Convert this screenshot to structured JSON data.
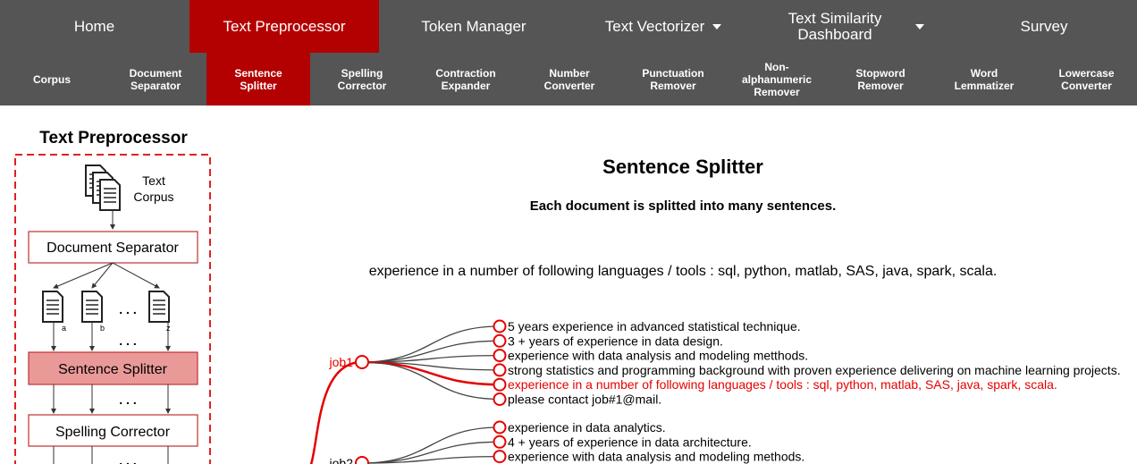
{
  "top_nav": [
    {
      "label": "Home"
    },
    {
      "label": "Text Preprocessor"
    },
    {
      "label": "Token Manager"
    },
    {
      "label": "Text Vectorizer"
    },
    {
      "label": "Text Similarity Dashboard"
    },
    {
      "label": "Survey"
    }
  ],
  "sub_nav": [
    {
      "label": "Corpus"
    },
    {
      "label": "Document Separator"
    },
    {
      "label": "Sentence Splitter"
    },
    {
      "label": "Spelling Corrector"
    },
    {
      "label": "Contraction Expander"
    },
    {
      "label": "Number Converter"
    },
    {
      "label": "Punctuation Remover"
    },
    {
      "label": "Non-alphanumeric Remover"
    },
    {
      "label": "Stopword Remover"
    },
    {
      "label": "Word Lemmatizer"
    },
    {
      "label": "Lowercase Converter"
    }
  ],
  "diagram": {
    "title": "Text Preprocessor",
    "corpus_label_1": "Text",
    "corpus_label_2": "Corpus",
    "doc_separator": "Document Separator",
    "sentence_splitter": "Sentence Splitter",
    "spelling_corrector": "Spelling Corrector",
    "doc_a": "a",
    "doc_b": "b",
    "doc_z": "z",
    "ellipsis": ". . ."
  },
  "content": {
    "title": "Sentence Splitter",
    "subtitle": "Each document is splitted into many sentences.",
    "selected_sentence": "experience in a number of following languages / tools : sql, python, matlab, SAS, java, spark, scala."
  },
  "tree": {
    "jobs": [
      {
        "label": "job1",
        "sentences": [
          "5 years experience in advanced statistical technique.",
          "3 + years of experience in data design.",
          "experience with data analysis and modeling metthods.",
          "strong statistics and programming background with proven experience delivering on machine learning projects.",
          "experience in a number of following languages / tools : sql, python, matlab, SAS, java, spark, scala.",
          "please contact job#1@mail."
        ]
      },
      {
        "label": "job2",
        "sentences": [
          "experience in data analytics.",
          "4 + years of experience in data architecture.",
          "experience with data analysis and modeling methods."
        ]
      }
    ],
    "highlight_color": "#e60000"
  }
}
